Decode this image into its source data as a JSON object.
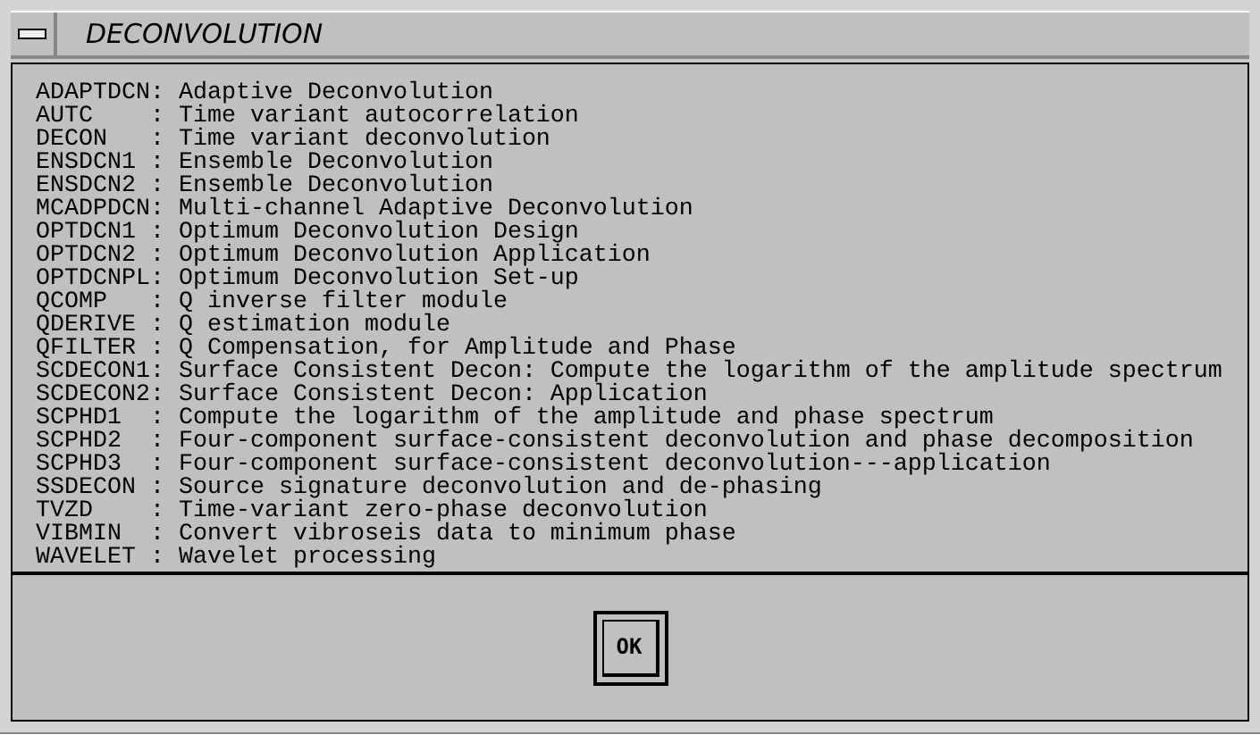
{
  "window": {
    "title": "DECONVOLUTION"
  },
  "lines": [
    "ADAPTDCN: Adaptive Deconvolution",
    "AUTC    : Time variant autocorrelation",
    "DECON   : Time variant deconvolution",
    "ENSDCN1 : Ensemble Deconvolution",
    "ENSDCN2 : Ensemble Deconvolution",
    "MCADPDCN: Multi-channel Adaptive Deconvolution",
    "OPTDCN1 : Optimum Deconvolution Design",
    "OPTDCN2 : Optimum Deconvolution Application",
    "OPTDCNPL: Optimum Deconvolution Set-up",
    "QCOMP   : Q inverse filter module",
    "QDERIVE : Q estimation module",
    "QFILTER : Q Compensation, for Amplitude and Phase",
    "SCDECON1: Surface Consistent Decon: Compute the logarithm of the amplitude spectrum",
    "SCDECON2: Surface Consistent Decon: Application",
    "SCPHD1  : Compute the logarithm of the amplitude and phase spectrum",
    "SCPHD2  : Four-component surface-consistent deconvolution and phase decomposition",
    "SCPHD3  : Four-component surface-consistent deconvolution---application",
    "SSDECON : Source signature deconvolution and de-phasing",
    "TVZD    : Time-variant zero-phase deconvolution",
    "VIBMIN  : Convert vibroseis data to minimum phase",
    "WAVELET : Wavelet processing"
  ],
  "buttons": [
    "OK"
  ]
}
